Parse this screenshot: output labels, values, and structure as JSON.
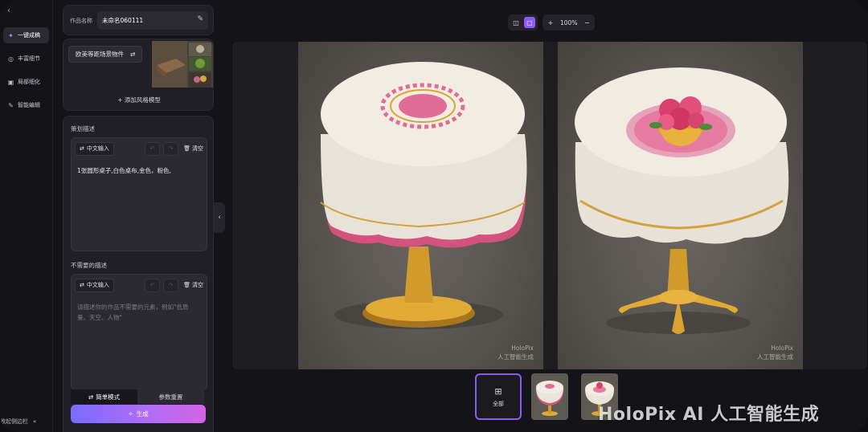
{
  "rail": {
    "items": [
      {
        "label": "一键成稿",
        "icon": "sparkle-icon"
      },
      {
        "label": "丰富细节",
        "icon": "enrich-icon"
      },
      {
        "label": "局部细化",
        "icon": "region-icon"
      },
      {
        "label": "智能编辑",
        "icon": "pen-icon"
      }
    ],
    "collapse_label": "收起侧边栏"
  },
  "panel": {
    "name_label": "作品名称",
    "name_value": "未命名060111",
    "style_tag": "欧美等距场景物件",
    "add_style": "添加风格模型",
    "desc_title": "策划描述",
    "desc_text": "1张圆形桌子,白色桌布,金色，粉色,",
    "neg_title": "不需要的描述",
    "neg_placeholder": "请描述你的作品不需要的元素，例如\"低质量、天空、人物\"",
    "cn_input": "中文输入",
    "clear": "清空",
    "mode_simple": "简单模式",
    "mode_reset": "参数重置",
    "generate": "生成"
  },
  "toolbar": {
    "zoom": "100%"
  },
  "canvas": {
    "watermark_line1": "HoloPix",
    "watermark_line2": "人工智能生成"
  },
  "thumbs": {
    "all_label": "全部"
  },
  "brand_watermark": "HoloPix AI 人工智能生成",
  "colors": {
    "accent": "#8b5cf6",
    "gen_start": "#7b6cff",
    "gen_end": "#d464e5",
    "bg": "#141418",
    "panel": "#1f1f25"
  }
}
